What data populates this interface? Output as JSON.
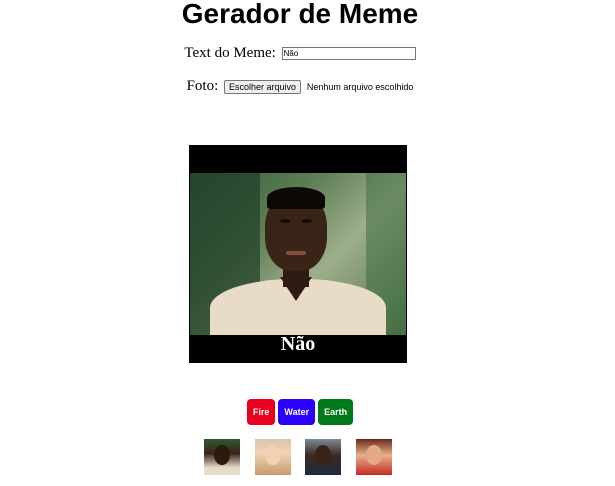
{
  "page": {
    "title": "Gerador de Meme"
  },
  "form": {
    "text_label": "Text do Meme:",
    "text_value": "Não",
    "photo_label": "Foto:",
    "file_button": "Escolher arquivo",
    "file_status": "Nenhum arquivo escolhido"
  },
  "meme": {
    "caption": "Não"
  },
  "elements": [
    {
      "label": "Fire",
      "color": "#e8001c"
    },
    {
      "label": "Water",
      "color": "#2a00ff"
    },
    {
      "label": "Earth",
      "color": "#007a1a"
    }
  ],
  "thumbnails": [
    "meme-thumb-1",
    "meme-thumb-2",
    "meme-thumb-3",
    "meme-thumb-4"
  ]
}
